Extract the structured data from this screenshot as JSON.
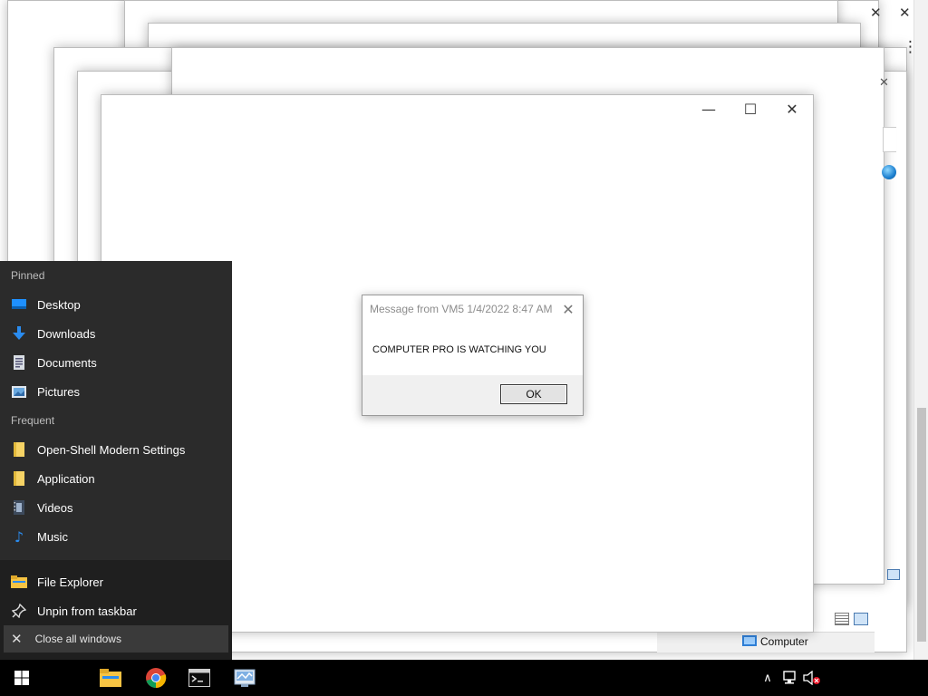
{
  "background_windows": {
    "close_glyph": "✕",
    "minimize_glyph": "—",
    "maximize_glyph": "☐",
    "more_glyph": "⋮"
  },
  "status_bar": {
    "location_label": "Computer"
  },
  "message_box": {
    "title": "Message from VM5 1/4/2022 8:47 AM",
    "close_glyph": "✕",
    "message": "COMPUTER PRO IS WATCHING YOU",
    "ok_label": "OK"
  },
  "jump_list": {
    "pinned_header": "Pinned",
    "pinned": [
      {
        "label": "Desktop",
        "icon": "desktop-icon"
      },
      {
        "label": "Downloads",
        "icon": "download-arrow-icon"
      },
      {
        "label": "Documents",
        "icon": "document-icon"
      },
      {
        "label": "Pictures",
        "icon": "picture-icon"
      }
    ],
    "frequent_header": "Frequent",
    "frequent": [
      {
        "label": "Open-Shell Modern Settings",
        "icon": "folder-icon"
      },
      {
        "label": "Application",
        "icon": "folder-icon"
      },
      {
        "label": "Videos",
        "icon": "video-icon"
      },
      {
        "label": "Music",
        "icon": "music-note-icon"
      }
    ],
    "actions": [
      {
        "label": "File Explorer",
        "icon": "file-explorer-icon"
      },
      {
        "label": "Unpin from taskbar",
        "icon": "unpin-icon"
      },
      {
        "label": "Close all windows",
        "icon": "close-icon"
      }
    ],
    "close_glyph": "✕"
  },
  "taskbar": {
    "apps": [
      {
        "name": "start-button",
        "icon": "windows-logo-icon"
      },
      {
        "name": "file-explorer",
        "icon": "folder-icon"
      },
      {
        "name": "chrome",
        "icon": "chrome-icon"
      },
      {
        "name": "command-prompt",
        "icon": "terminal-icon"
      },
      {
        "name": "control-panel",
        "icon": "control-panel-icon"
      }
    ],
    "tray": {
      "chevron": "∧",
      "network_icon": "network-icon",
      "volume_icon": "volume-muted-icon"
    }
  },
  "colors": {
    "taskbar": "#000000",
    "jump_list_bg": "#2b2b2b",
    "jump_list_bottom": "#1f1f1f",
    "folder": "#f6d365",
    "accent_blue": "#1e90ff"
  }
}
